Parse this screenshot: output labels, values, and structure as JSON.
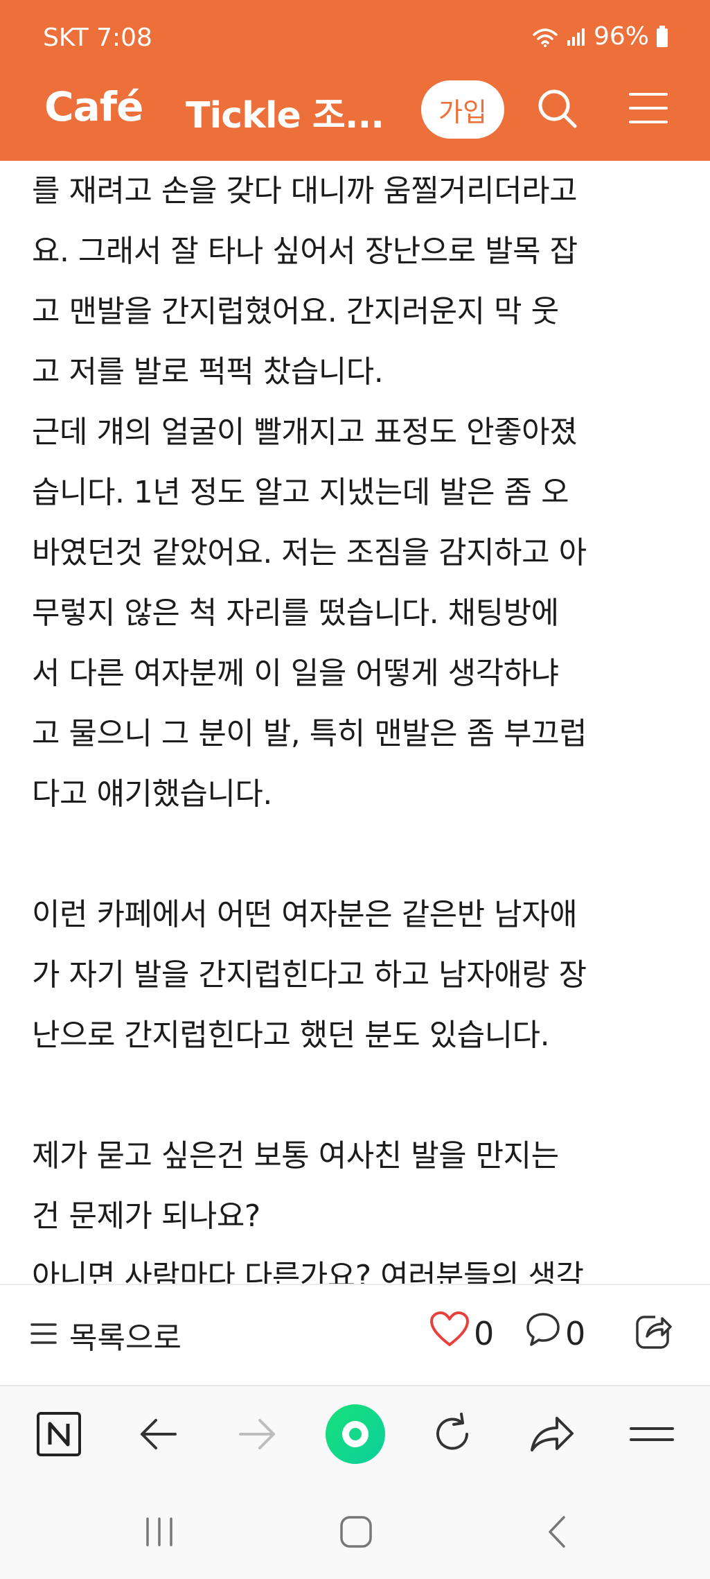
{
  "status_bar": {
    "carrier_time": "SKT 7:08",
    "battery": "96%"
  },
  "app_bar": {
    "logo": "Café",
    "cafe_title": "Tickle 조...",
    "join_label": "가입"
  },
  "article": {
    "lines": [
      "를 재려고 손을 갖다 대니까 움찔거리더라고",
      "요. 그래서 잘 타나 싶어서 장난으로 발목 잡",
      "고 맨발을 간지럽혔어요. 간지러운지 막 웃",
      "고 저를 발로 퍽퍽 찼습니다.",
      "근데 걔의 얼굴이 빨개지고 표정도 안좋아졌",
      "습니다. 1년 정도 알고 지냈는데 발은 좀 오",
      "바였던것 같았어요. 저는 조짐을 감지하고 아",
      "무렇지 않은 척 자리를 떴습니다. 채팅방에",
      "서 다른 여자분께 이 일을 어떻게 생각하냐",
      "고 물으니 그 분이 발, 특히 맨발은 좀 부끄럽",
      "다고 얘기했습니다.",
      "",
      "이런 카페에서 어떤 여자분은 같은반 남자애",
      "가 자기 발을 간지럽힌다고 하고 남자애랑 장",
      "난으로 간지럽힌다고 했던 분도 있습니다.",
      "",
      "제가 묻고 싶은건 보통 여사친 발을 만지는",
      "건 문제가 되나요?",
      "아니면 사람마다 다른가요? 여러분들의 생각"
    ]
  },
  "action_bar": {
    "list_label": "목록으로",
    "like_count": "0",
    "comment_count": "0"
  },
  "colors": {
    "brand": "#ed6f3a",
    "like": "#e8413c",
    "home_green": "#18e07a"
  }
}
